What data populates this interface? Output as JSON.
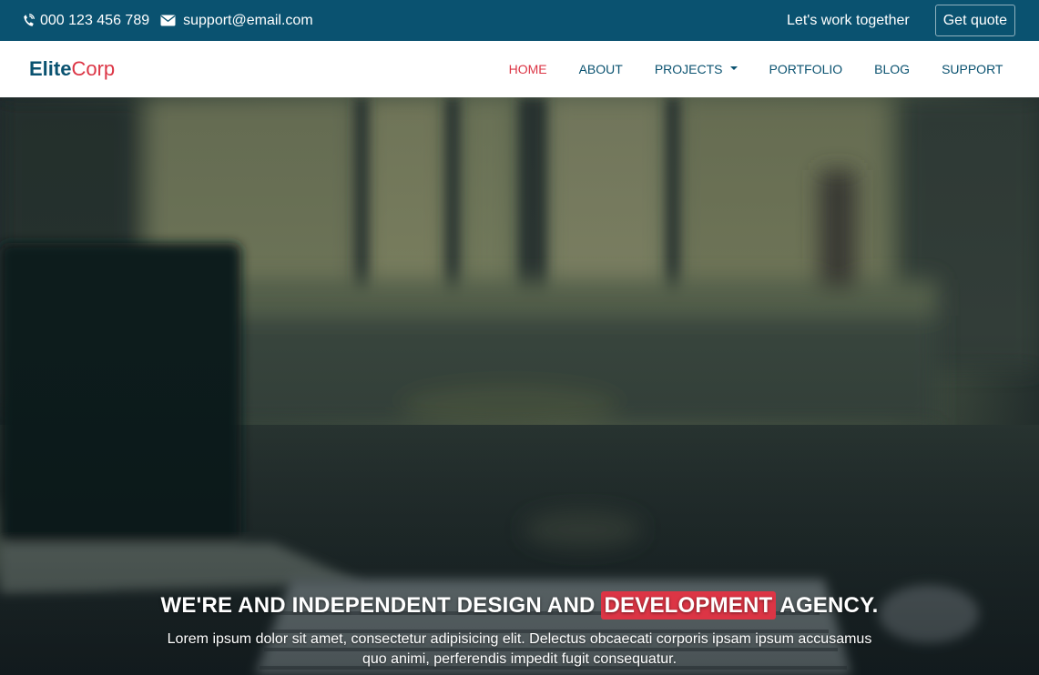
{
  "topbar": {
    "phone": "000 123 456 789",
    "email": "support@email.com",
    "tagline": "Let's work together",
    "quote_label": "Get quote",
    "phone_icon": "phone-icon",
    "mail_icon": "envelope-icon"
  },
  "brand": {
    "part1": "Elite",
    "part2": "Corp"
  },
  "nav": {
    "items": [
      {
        "label": "HOME",
        "active": true
      },
      {
        "label": "ABOUT"
      },
      {
        "label": "PROJECTS",
        "dropdown": true
      },
      {
        "label": "PORTFOLIO"
      },
      {
        "label": "BLOG"
      },
      {
        "label": "SUPPORT"
      }
    ]
  },
  "hero": {
    "title_before": "WE'RE AND INDEPENDENT DESIGN AND",
    "title_highlight": "DEVELOPMENT",
    "title_after": "AGENCY.",
    "subtitle": "Lorem ipsum dolor sit amet, consectetur adipisicing elit. Delectus obcaecati corporis ipsam ipsum accusamus quo animi, perferendis impedit fugit consequatur."
  },
  "colors": {
    "topbar_bg": "#0a5270",
    "brand_primary": "#0a5270",
    "accent_red": "#dc3545",
    "nav_text": "#0a5270"
  }
}
